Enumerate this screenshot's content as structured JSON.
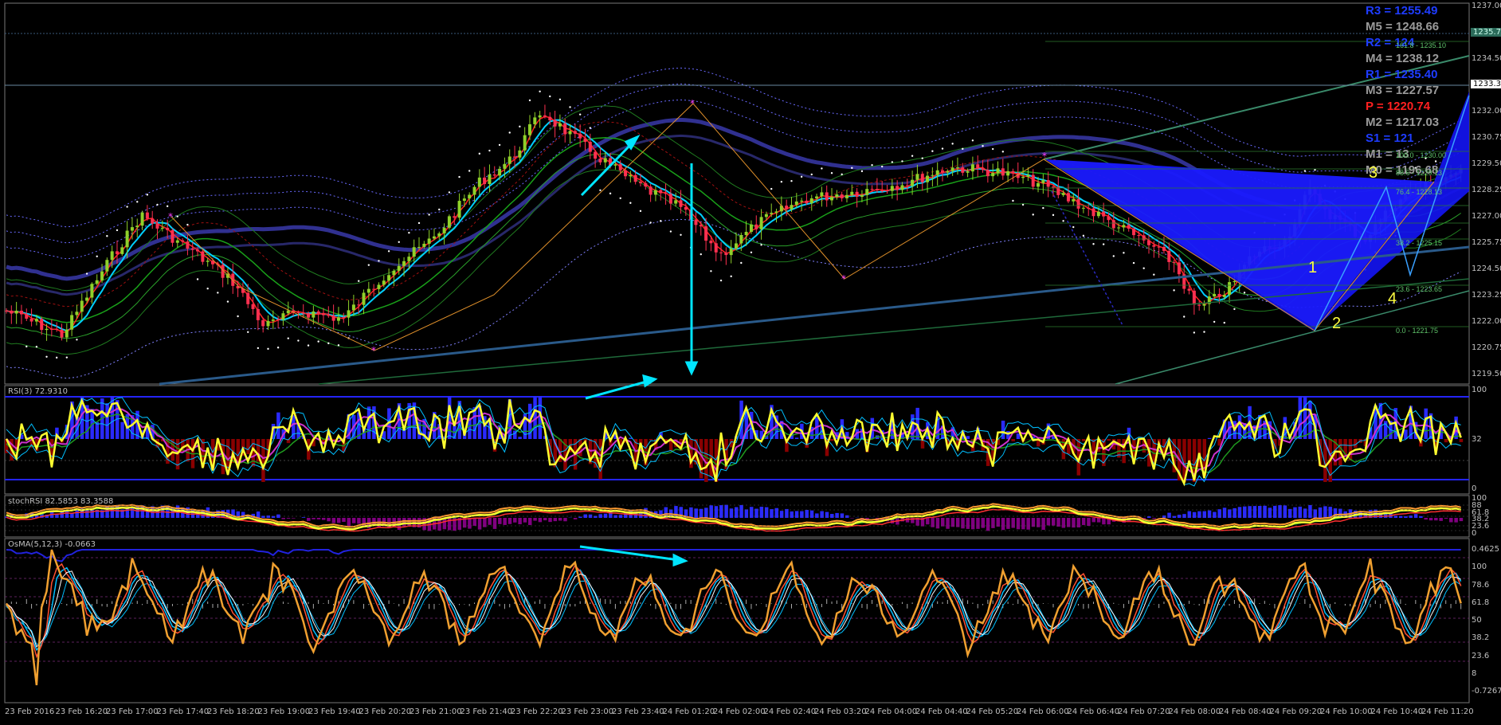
{
  "pivots": [
    {
      "label": "R3 = 1255.49",
      "color": "#1e3cff"
    },
    {
      "label": "M5 = 1248.66",
      "color": "#9a9a9a"
    },
    {
      "label": "R2 = 124",
      "color": "#1e3cff"
    },
    {
      "label": "M4 = 1238.12",
      "color": "#9a9a9a"
    },
    {
      "label": "R1 = 1235.40",
      "color": "#1e3cff"
    },
    {
      "label": "M3 = 1227.57",
      "color": "#9a9a9a"
    },
    {
      "label": "P   = 1220.74",
      "color": "#ff2020"
    },
    {
      "label": "M2 = 1217.03",
      "color": "#9a9a9a"
    },
    {
      "label": "S1 = 121",
      "color": "#1e3cff"
    },
    {
      "label": "M1 = 13",
      "color": "#9a9a9a"
    },
    {
      "label": "M0 = 1196.68",
      "color": "#9a9a9a"
    }
  ],
  "fib_labels": [
    "161.8 - 1235.10",
    "100.0 - 1230.00",
    "88.6 - 1229.13",
    "76.4 - 1228.13",
    "38.2 - 1225.15",
    "23.6 - 1223.65",
    "0.0 - 1221.75"
  ],
  "price_axis": [
    "1237.00",
    "1235.75",
    "1234.50",
    "1233.34",
    "1232.00",
    "1230.75",
    "1229.50",
    "1228.25",
    "1227.00",
    "1225.75",
    "1224.50",
    "1223.25",
    "1222.00",
    "1220.75",
    "1219.50"
  ],
  "price_tags": {
    "current": "1233.34",
    "fib": "1235.75"
  },
  "time_axis": [
    "23 Feb 2016",
    "23 Feb 16:20",
    "23 Feb 17:00",
    "23 Feb 17:40",
    "23 Feb 18:20",
    "23 Feb 19:00",
    "23 Feb 19:40",
    "23 Feb 20:20",
    "23 Feb 21:00",
    "23 Feb 21:40",
    "23 Feb 22:20",
    "23 Feb 23:00",
    "23 Feb 23:40",
    "24 Feb 01:20",
    "24 Feb 02:00",
    "24 Feb 02:40",
    "24 Feb 03:20",
    "24 Feb 04:00",
    "24 Feb 04:40",
    "24 Feb 05:20",
    "24 Feb 06:00",
    "24 Feb 06:40",
    "24 Feb 07:20",
    "24 Feb 08:00",
    "24 Feb 08:40",
    "24 Feb 09:20",
    "24 Feb 10:00",
    "24 Feb 10:40",
    "24 Feb 11:20"
  ],
  "indicators": {
    "rsi": {
      "title": "RSI(3) 72.9310",
      "levels": [
        "100",
        "32",
        "0"
      ]
    },
    "stoch": {
      "title": "stochRSI 82.5853 83.3588",
      "levels": [
        "100",
        "88",
        "61.8",
        "38.2",
        "23.6",
        "0"
      ]
    },
    "osma": {
      "title": "OsMA(5,12,3) -0.0663",
      "levels": [
        "0.4625",
        "100",
        "78.6",
        "61.8",
        "50",
        "38.2",
        "23.6",
        "8",
        "-0.7267"
      ]
    }
  },
  "waves": [
    "1",
    "2",
    "3",
    "4"
  ]
}
